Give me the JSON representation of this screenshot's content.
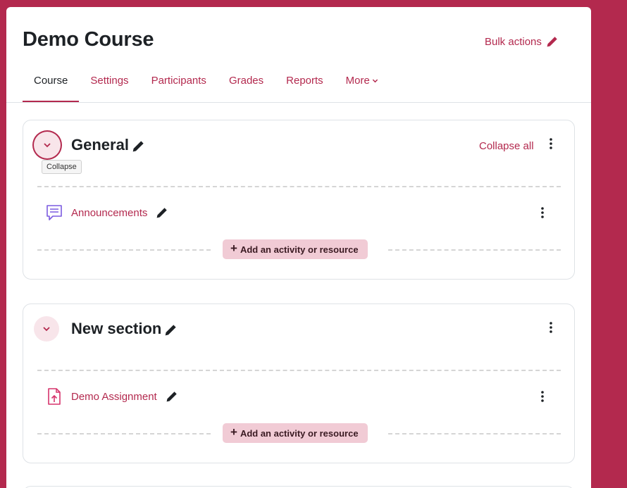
{
  "course": {
    "title": "Demo Course",
    "bulk_actions": "Bulk actions"
  },
  "tabs": [
    {
      "label": "Course"
    },
    {
      "label": "Settings"
    },
    {
      "label": "Participants"
    },
    {
      "label": "Grades"
    },
    {
      "label": "Reports"
    },
    {
      "label": "More"
    }
  ],
  "sections": [
    {
      "title": "General",
      "collapse_all": "Collapse all",
      "tooltip": "Collapse",
      "activity": {
        "name": "Announcements",
        "icon": "forum-icon"
      },
      "add_label": "Add an activity or resource"
    },
    {
      "title": "New section",
      "activity": {
        "name": "Demo Assignment",
        "icon": "assignment-upload-icon"
      },
      "add_label": "Add an activity or resource"
    }
  ],
  "colors": {
    "brand": "#b3294e",
    "page_bg": "#b3294e",
    "button_bg": "#f1cbd5",
    "forum_icon": "#7c5ce0",
    "assignment_icon": "#d6336c"
  }
}
